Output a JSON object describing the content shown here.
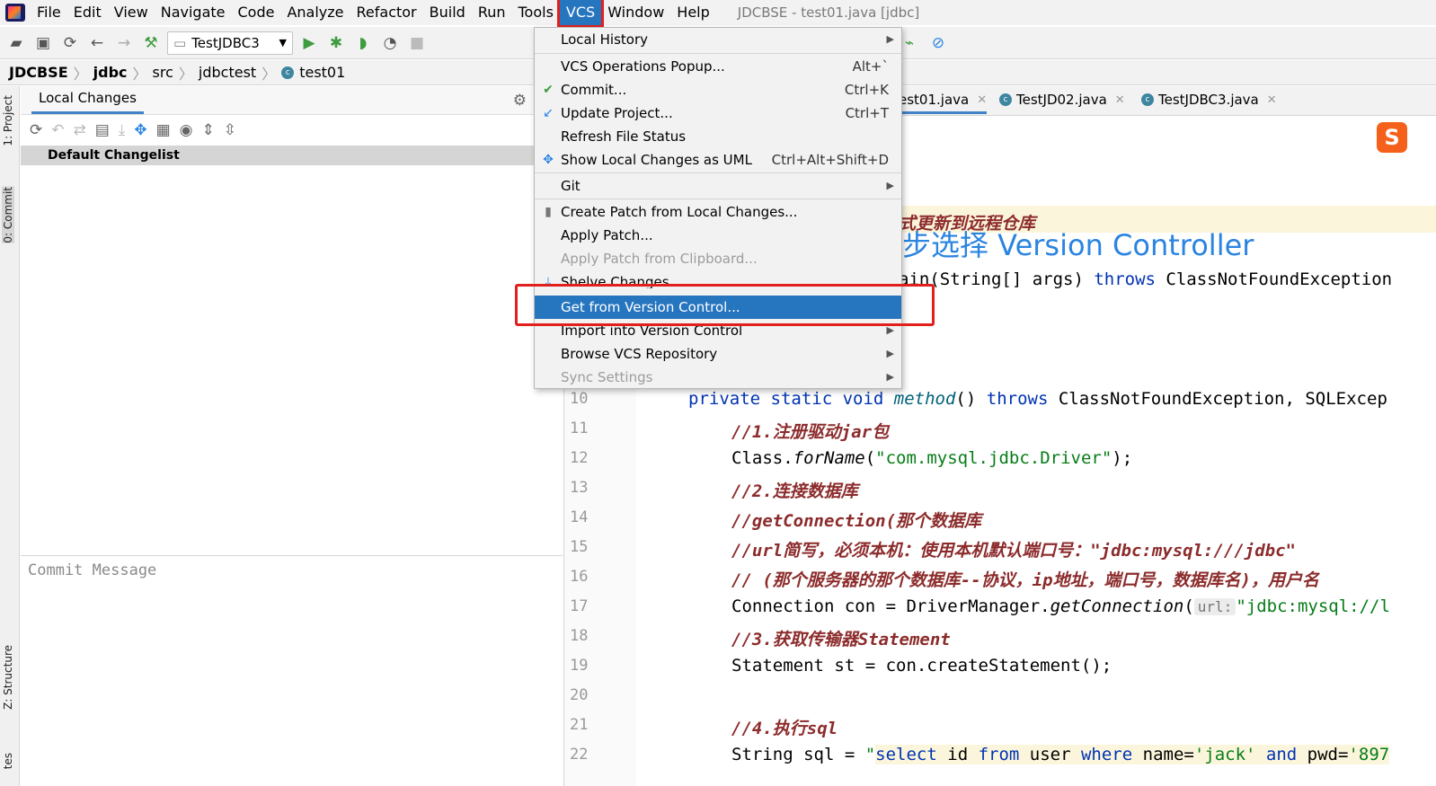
{
  "menubar": {
    "items": [
      "File",
      "Edit",
      "View",
      "Navigate",
      "Code",
      "Analyze",
      "Refactor",
      "Build",
      "Run",
      "Tools",
      "VCS",
      "Window",
      "Help"
    ],
    "window_title": "JDCBSE - test01.java [jdbc]"
  },
  "toolbar": {
    "run_config": "TestJDBC3"
  },
  "breadcrumb": [
    "JDCBSE",
    "jdbc",
    "src",
    "jdbctest",
    "test01"
  ],
  "left_strip": {
    "project": "1: Project",
    "commit": "0: Commit",
    "structure": "Z: Structure",
    "tes": "tes"
  },
  "commit_panel": {
    "tab": "Local Changes",
    "changelist": "Default Changelist",
    "commit_placeholder": "Commit Message"
  },
  "editor_tabs": [
    "est01.java",
    "TestJD02.java",
    "TestJDBC3.java"
  ],
  "vcs_menu": {
    "local_history": "Local History",
    "ops_popup": "VCS Operations Popup...",
    "ops_popup_sc": "Alt+`",
    "commit": "Commit...",
    "commit_sc": "Ctrl+K",
    "update": "Update Project...",
    "update_sc": "Ctrl+T",
    "refresh": "Refresh File Status",
    "uml": "Show Local Changes as UML",
    "uml_sc": "Ctrl+Alt+Shift+D",
    "git": "Git",
    "create_patch": "Create Patch from Local Changes...",
    "apply_patch": "Apply Patch...",
    "apply_clip": "Apply Patch from Clipboard...",
    "shelve": "Shelve Changes",
    "get_vc": "Get from Version Control...",
    "import_vc": "Import into Version Control",
    "browse": "Browse VCS Repository",
    "sync": "Sync Settings"
  },
  "annotation": {
    "title": "第三步选择 Version Controller",
    "partial_comment": "式更新到远程仓库"
  },
  "code": {
    "l9_a": "ain(String[] args) ",
    "l9_kw": "throws",
    "l9_b": " ClassNotFoundException",
    "lines": [
      {
        "n": "10"
      },
      {
        "n": "11"
      },
      {
        "n": "12"
      },
      {
        "n": "13"
      },
      {
        "n": "14"
      },
      {
        "n": "15"
      },
      {
        "n": "16"
      },
      {
        "n": "17"
      },
      {
        "n": "18"
      },
      {
        "n": "19"
      },
      {
        "n": "20"
      },
      {
        "n": "21"
      },
      {
        "n": "22"
      }
    ],
    "l10_kw1": "private static void ",
    "l10_m": "method",
    "l10_a": "() ",
    "l10_kw2": "throws",
    "l10_b": " ClassNotFoundException, SQLExcep",
    "l11": "//1.注册驱动jar包",
    "l12_a": "Class.",
    "l12_m": "forName",
    "l12_b": "(",
    "l12_s": "\"com.mysql.jdbc.Driver\"",
    "l12_c": ");",
    "l13": "//2.连接数据库",
    "l14": "//getConnection(那个数据库",
    "l15": "//url简写，必须本机：使用本机默认端口号：\"jdbc:mysql:///jdbc\"",
    "l16": "// (那个服务器的那个数据库--协议，ip地址，端口号，数据库名)，用户名",
    "l17_a": "Connection con = DriverManager.",
    "l17_m": "getConnection",
    "l17_b": "(",
    "l17_hint": "url:",
    "l17_s": "\"jdbc:mysql://l",
    "l18": "//3.获取传输器Statement",
    "l19": "Statement st = con.createStatement();",
    "l21": "//4.执行sql",
    "l22_a": "String sql = ",
    "l22_q": "\"",
    "l22_s1": "select",
    "l22_s2": " id ",
    "l22_s3": "from",
    "l22_s4": " user ",
    "l22_s5": "where",
    "l22_s6": " name=",
    "l22_s7": "'jack'",
    "l22_s8": " and",
    "l22_s9": " pwd=",
    "l22_s10": "'897"
  }
}
